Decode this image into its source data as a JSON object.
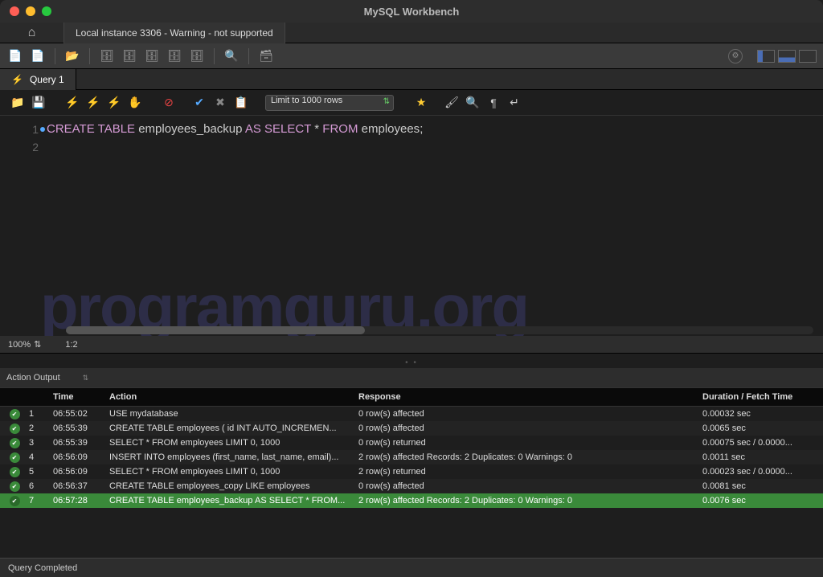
{
  "app_title": "MySQL Workbench",
  "connection_tab": "Local instance 3306 - Warning - not supported",
  "query_tab": "Query 1",
  "limit_select": "Limit to 1000 rows",
  "code": {
    "line1_tokens": [
      "CREATE",
      "TABLE",
      "employees_backup",
      "AS",
      "SELECT",
      "*",
      "FROM",
      "employees",
      ";"
    ],
    "line1_classes": [
      "kw",
      "kw",
      "ident",
      "kw",
      "kw",
      "op",
      "kw",
      "ident",
      "op"
    ]
  },
  "watermark": "programguru.org",
  "editor_status": {
    "zoom": "100%",
    "pos": "1:2"
  },
  "output_label": "Action Output",
  "table_headers": {
    "time": "Time",
    "action": "Action",
    "response": "Response",
    "duration": "Duration / Fetch Time"
  },
  "rows": [
    {
      "n": "1",
      "time": "06:55:02",
      "action": "USE mydatabase",
      "response": "0 row(s) affected",
      "duration": "0.00032 sec"
    },
    {
      "n": "2",
      "time": "06:55:39",
      "action": "CREATE TABLE employees (     id INT AUTO_INCREMEN...",
      "response": "0 row(s) affected",
      "duration": "0.0065 sec"
    },
    {
      "n": "3",
      "time": "06:55:39",
      "action": "SELECT * FROM employees LIMIT 0, 1000",
      "response": "0 row(s) returned",
      "duration": "0.00075 sec / 0.0000..."
    },
    {
      "n": "4",
      "time": "06:56:09",
      "action": "INSERT INTO employees (first_name, last_name, email)...",
      "response": "2 row(s) affected Records: 2  Duplicates: 0  Warnings: 0",
      "duration": "0.0011 sec"
    },
    {
      "n": "5",
      "time": "06:56:09",
      "action": "SELECT * FROM employees LIMIT 0, 1000",
      "response": "2 row(s) returned",
      "duration": "0.00023 sec / 0.0000..."
    },
    {
      "n": "6",
      "time": "06:56:37",
      "action": "CREATE TABLE employees_copy LIKE employees",
      "response": "0 row(s) affected",
      "duration": "0.0081 sec"
    },
    {
      "n": "7",
      "time": "06:57:28",
      "action": "CREATE TABLE employees_backup AS SELECT * FROM...",
      "response": "2 row(s) affected Records: 2  Duplicates: 0  Warnings: 0",
      "duration": "0.0076 sec"
    }
  ],
  "footer": "Query Completed"
}
